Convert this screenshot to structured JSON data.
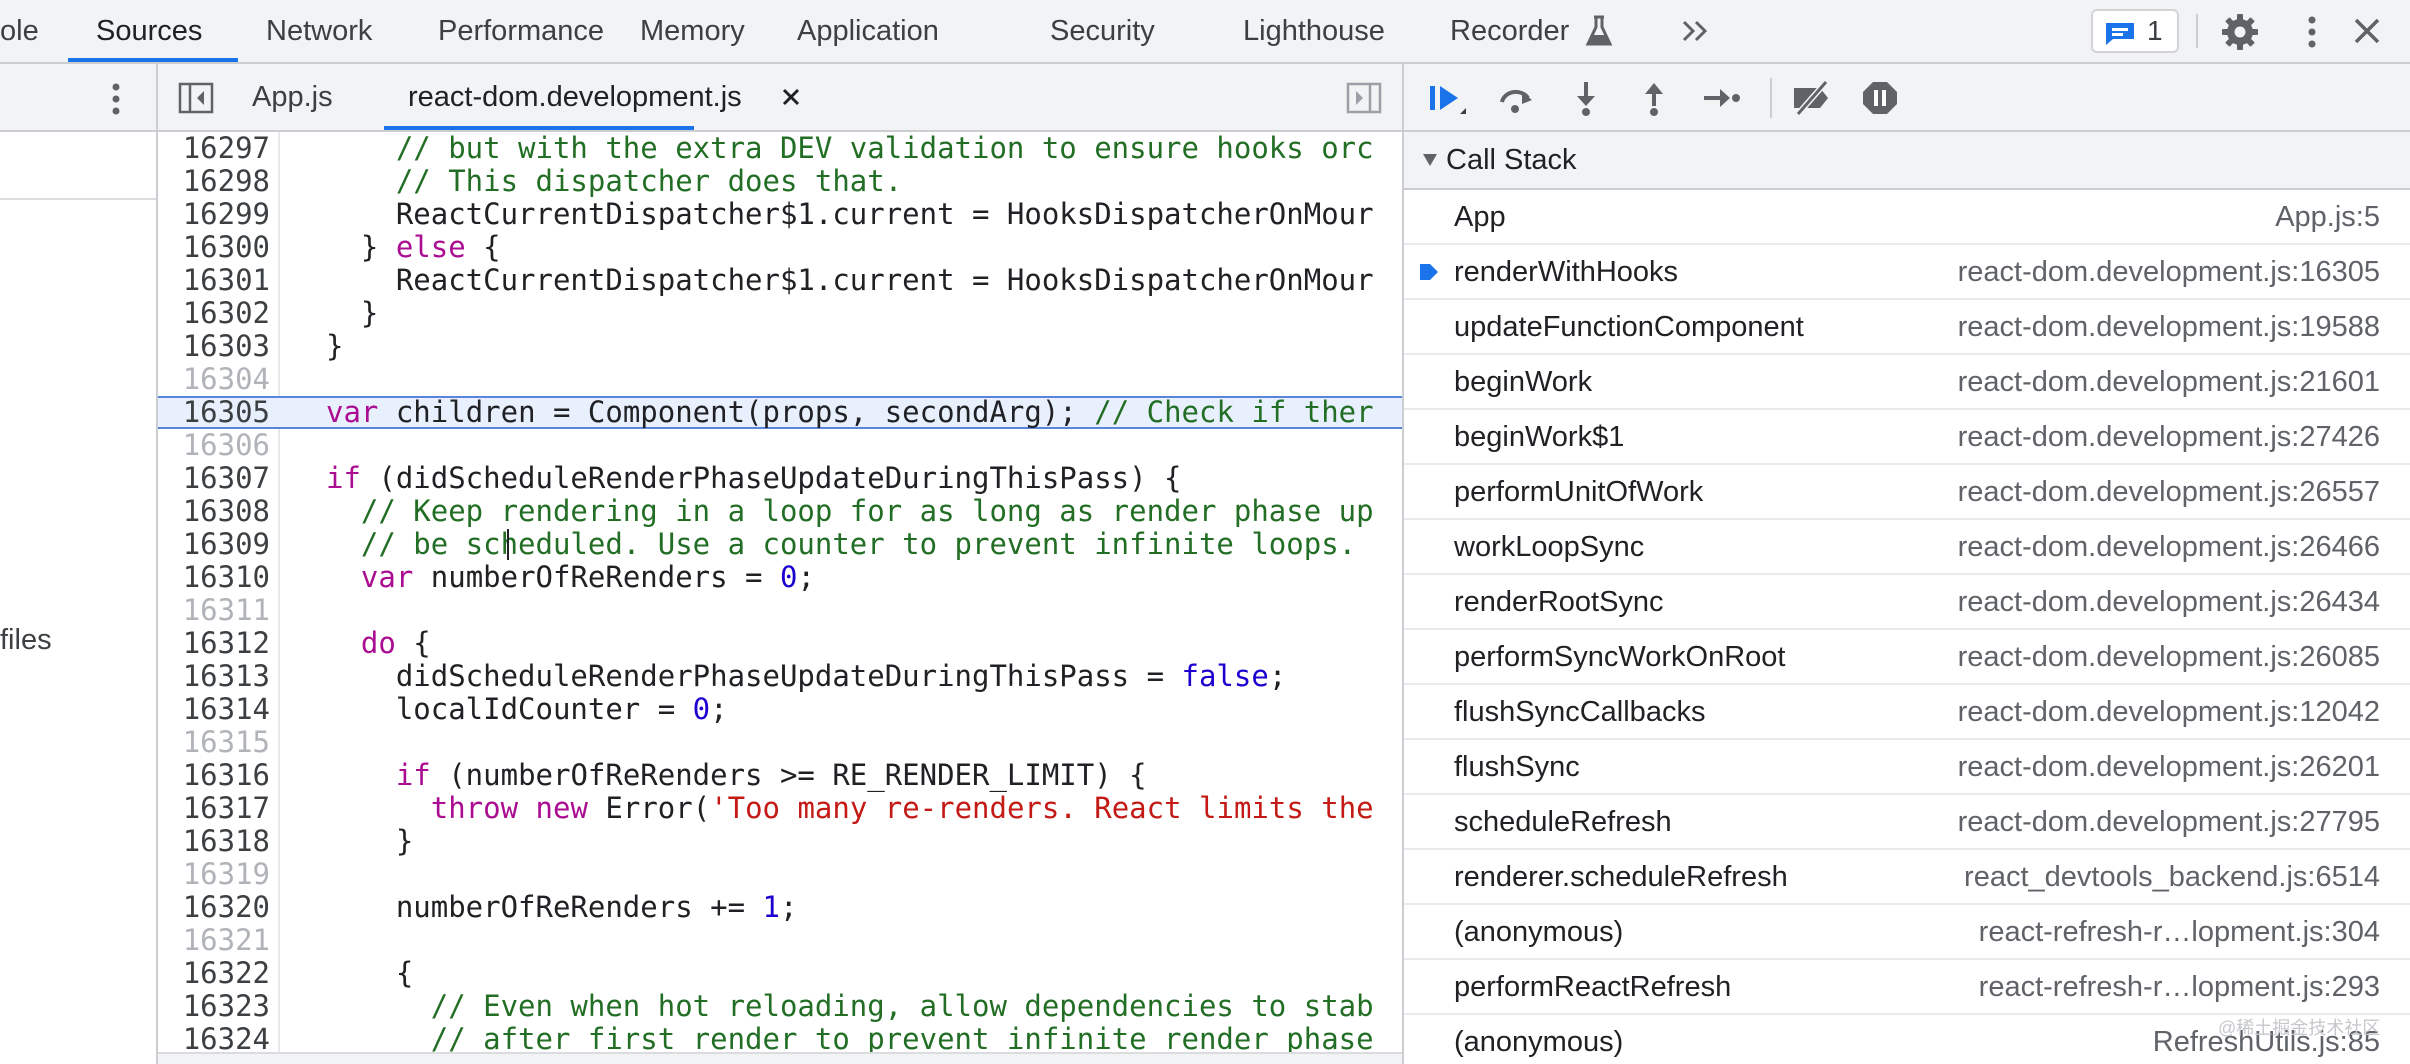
{
  "top_tabs": {
    "console_partial": "ole",
    "sources": "Sources",
    "network": "Network",
    "performance": "Performance",
    "memory": "Memory",
    "application": "Application",
    "security": "Security",
    "lighthouse": "Lighthouse",
    "recorder": "Recorder"
  },
  "toolbar": {
    "issues_count": "1"
  },
  "navigator": {
    "files_label": "files"
  },
  "editor": {
    "tabs": [
      {
        "label": "App.js",
        "active": false
      },
      {
        "label": "react-dom.development.js",
        "active": true
      }
    ],
    "paused_line": 16305,
    "lines": [
      {
        "num": "16297",
        "dim": false,
        "code": "    // but with the extra DEV validation to ensure hooks orc"
      },
      {
        "num": "16298",
        "dim": false,
        "code": "    // This dispatcher does that."
      },
      {
        "num": "16299",
        "dim": false,
        "code": "    ReactCurrentDispatcher$1.current = HooksDispatcherOnMour"
      },
      {
        "num": "16300",
        "dim": false,
        "code": "  } else {"
      },
      {
        "num": "16301",
        "dim": false,
        "code": "    ReactCurrentDispatcher$1.current = HooksDispatcherOnMour"
      },
      {
        "num": "16302",
        "dim": false,
        "code": "  }"
      },
      {
        "num": "16303",
        "dim": false,
        "code": "}"
      },
      {
        "num": "16304",
        "dim": true,
        "code": ""
      },
      {
        "num": "16305",
        "dim": false,
        "code": "var children = Component(props, secondArg); // Check if ther"
      },
      {
        "num": "16306",
        "dim": true,
        "code": ""
      },
      {
        "num": "16307",
        "dim": false,
        "code": "if (didScheduleRenderPhaseUpdateDuringThisPass) {"
      },
      {
        "num": "16308",
        "dim": false,
        "code": "  // Keep rendering in a loop for as long as render phase up"
      },
      {
        "num": "16309",
        "dim": false,
        "code": "  // be scheduled. Use a counter to prevent infinite loops."
      },
      {
        "num": "16310",
        "dim": false,
        "code": "  var numberOfReRenders = 0;"
      },
      {
        "num": "16311",
        "dim": true,
        "code": ""
      },
      {
        "num": "16312",
        "dim": false,
        "code": "  do {"
      },
      {
        "num": "16313",
        "dim": false,
        "code": "    didScheduleRenderPhaseUpdateDuringThisPass = false;"
      },
      {
        "num": "16314",
        "dim": false,
        "code": "    localIdCounter = 0;"
      },
      {
        "num": "16315",
        "dim": true,
        "code": ""
      },
      {
        "num": "16316",
        "dim": false,
        "code": "    if (numberOfReRenders >= RE_RENDER_LIMIT) {"
      },
      {
        "num": "16317",
        "dim": false,
        "code": "      throw new Error('Too many re-renders. React limits the"
      },
      {
        "num": "16318",
        "dim": false,
        "code": "    }"
      },
      {
        "num": "16319",
        "dim": true,
        "code": ""
      },
      {
        "num": "16320",
        "dim": false,
        "code": "    numberOfReRenders += 1;"
      },
      {
        "num": "16321",
        "dim": true,
        "code": ""
      },
      {
        "num": "16322",
        "dim": false,
        "code": "    {"
      },
      {
        "num": "16323",
        "dim": false,
        "code": "      // Even when hot reloading, allow dependencies to stab"
      },
      {
        "num": "16324",
        "dim": false,
        "code": "      // after first render to prevent infinite render phase"
      }
    ]
  },
  "call_stack": {
    "title": "Call Stack",
    "frames": [
      {
        "name": "App",
        "location": "App.js:5",
        "current": false
      },
      {
        "name": "renderWithHooks",
        "location": "react-dom.development.js:16305",
        "current": true
      },
      {
        "name": "updateFunctionComponent",
        "location": "react-dom.development.js:19588",
        "current": false
      },
      {
        "name": "beginWork",
        "location": "react-dom.development.js:21601",
        "current": false
      },
      {
        "name": "beginWork$1",
        "location": "react-dom.development.js:27426",
        "current": false
      },
      {
        "name": "performUnitOfWork",
        "location": "react-dom.development.js:26557",
        "current": false
      },
      {
        "name": "workLoopSync",
        "location": "react-dom.development.js:26466",
        "current": false
      },
      {
        "name": "renderRootSync",
        "location": "react-dom.development.js:26434",
        "current": false
      },
      {
        "name": "performSyncWorkOnRoot",
        "location": "react-dom.development.js:26085",
        "current": false
      },
      {
        "name": "flushSyncCallbacks",
        "location": "react-dom.development.js:12042",
        "current": false
      },
      {
        "name": "flushSync",
        "location": "react-dom.development.js:26201",
        "current": false
      },
      {
        "name": "scheduleRefresh",
        "location": "react-dom.development.js:27795",
        "current": false
      },
      {
        "name": "renderer.scheduleRefresh",
        "location": "react_devtools_backend.js:6514",
        "current": false
      },
      {
        "name": "(anonymous)",
        "location": "react-refresh-r…lopment.js:304",
        "current": false
      },
      {
        "name": "performReactRefresh",
        "location": "react-refresh-r…lopment.js:293",
        "current": false
      },
      {
        "name": "(anonymous)",
        "location": "RefreshUtils.js:85",
        "current": false
      }
    ]
  },
  "watermark": "@稀土掘金技术社区",
  "colors": {
    "accent": "#1a73e8",
    "keyword": "#aa0d91",
    "comment": "#236e25",
    "number": "#1c00cf",
    "string": "#c41a16",
    "paused_line_bg": "#e8f0fe"
  }
}
